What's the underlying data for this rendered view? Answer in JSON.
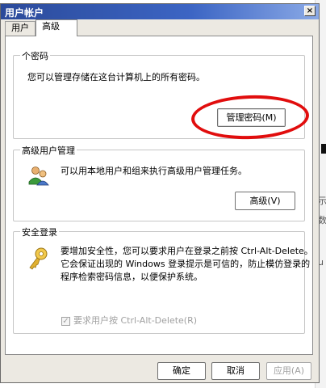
{
  "window": {
    "title": "用户帐户",
    "close_label": "×"
  },
  "tabs": [
    {
      "label": "用户"
    },
    {
      "label": "高级"
    }
  ],
  "passwords": {
    "legend": "个密码",
    "description": "您可以管理存储在这台计算机上的所有密码。",
    "button": "管理密码(M)"
  },
  "advanced": {
    "legend": "高级用户管理",
    "description": "可以用本地用户和组来执行高级用户管理任务。",
    "button": "高级(V)"
  },
  "secure": {
    "legend": "安全登录",
    "lines": [
      "要增加安全性，您可以要求用户在登录之前按 Ctrl-Alt-Delete。",
      "它会保证出现的 Windows 登录提示是可信的，防止模仿登录的",
      "程序检索密码信息，以便保护系统。"
    ],
    "checkbox_label": "要求用户按 Ctrl-Alt-Delete(R)",
    "checkbox_checked": true
  },
  "buttons": {
    "ok": "确定",
    "cancel": "取消",
    "apply": "应用(A)"
  },
  "background": {
    "glyph1": "i",
    "glyph2": "示",
    "glyph3": "数",
    "glyph4": "u"
  },
  "colors": {
    "annotation_ring": "#e10d0d",
    "titlebar": "#3c65c4"
  },
  "icons": {
    "users": "users-icon",
    "key": "key-icon"
  }
}
